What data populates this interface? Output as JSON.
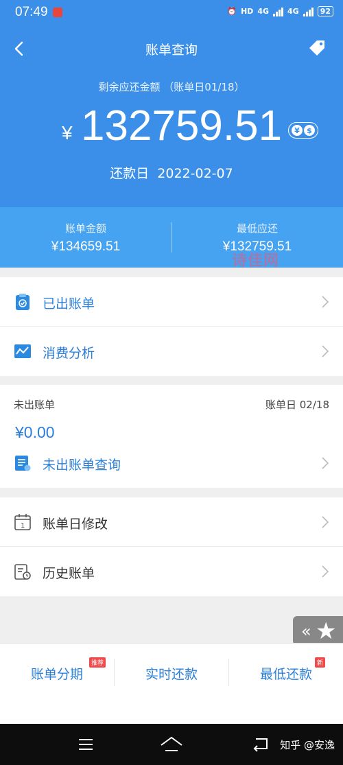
{
  "status": {
    "time": "07:49",
    "net1": "4G",
    "net2": "4G",
    "battery": "92"
  },
  "header": {
    "title": "账单查询",
    "subtitle": "剩余应还金额 （账单日01/18）",
    "currency_symbol": "¥",
    "amount": "132759.51",
    "due_label": "还款日",
    "due_date": "2022-02-07"
  },
  "summary": {
    "bill_label": "账单金额",
    "bill_value": "¥134659.51",
    "min_label": "最低应还",
    "min_value": "¥132759.51"
  },
  "watermark": "诗佳网",
  "menu1": [
    {
      "label": "已出账单",
      "icon": "clipboard-check-icon"
    },
    {
      "label": "消费分析",
      "icon": "chart-trend-icon"
    }
  ],
  "unbilled": {
    "title": "未出账单",
    "date": "账单日 02/18",
    "amount": "¥0.00",
    "query_label": "未出账单查询"
  },
  "menu2": [
    {
      "label": "账单日修改",
      "icon": "calendar-icon"
    },
    {
      "label": "历史账单",
      "icon": "history-bill-icon"
    }
  ],
  "actions": {
    "installment": "账单分期",
    "installment_badge": "推荐",
    "realtime": "实时还款",
    "minimum": "最低还款",
    "minimum_badge": "新"
  },
  "nav": {
    "credit": "知乎 @安逸"
  },
  "colors": {
    "primary": "#3b8fe8",
    "summary_bar": "#46a3f1",
    "link": "#2b7fd8",
    "badge": "#ef4b4b"
  }
}
